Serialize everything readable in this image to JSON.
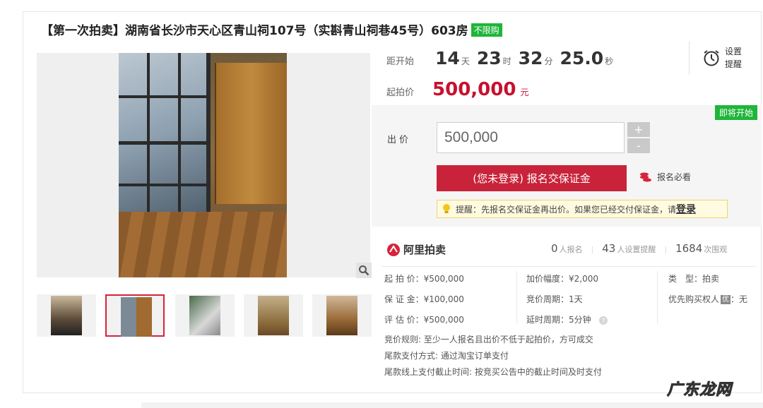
{
  "title": "【第一次拍卖】湖南省长沙市天心区青山祠107号（实斟青山祠巷45号）603房",
  "tag_unlimited": "不限购",
  "countdown": {
    "label": "距开始",
    "days": "14",
    "days_unit": "天",
    "hours": "23",
    "hours_unit": "时",
    "minutes": "32",
    "minutes_unit": "分",
    "seconds": "25.0",
    "seconds_unit": "秒"
  },
  "remind": {
    "line1": "设置",
    "line2": "提醒"
  },
  "start_price": {
    "label": "起拍价",
    "value": "500,000",
    "unit": "元"
  },
  "coming_tag": "即将开始",
  "bid": {
    "label": "出价",
    "value": "500,000",
    "plus": "+",
    "minus": "-"
  },
  "signup_button": "(您未登录) 报名交保证金",
  "must_see": "报名必看",
  "tip": {
    "text": "提醒：先报名交保证金再出价。如果您已经交付保证金，请",
    "login": "登录"
  },
  "platform": "阿里拍卖",
  "stats": [
    {
      "num": "0",
      "label": "人报名"
    },
    {
      "num": "43",
      "label": "人设置提醒"
    },
    {
      "num": "1684",
      "label": "次围观"
    }
  ],
  "info": {
    "col1": [
      "起 拍 价：¥500,000",
      "保 证 金：¥100,000",
      "评 估 价：¥500,000"
    ],
    "col2": [
      "加价幅度：¥2,000",
      "竞价周期：1天",
      "延时周期：5分钟"
    ],
    "col3_type": "类　型：拍卖",
    "col3_priority_label": "优先购买权人",
    "col3_priority_badge": "优",
    "col3_priority_value": "：无"
  },
  "rules": [
    "竞价规则:   至少一人报名且出价不低于起拍价，方可成交",
    "尾款支付方式:   通过淘宝订单支付",
    "尾款线上支付截止时间:   按竞买公告中的截止时间及时支付"
  ],
  "watermark": "广东龙网",
  "colors": {
    "accent_red": "#c8233a",
    "green_tag": "#1fb53a"
  }
}
